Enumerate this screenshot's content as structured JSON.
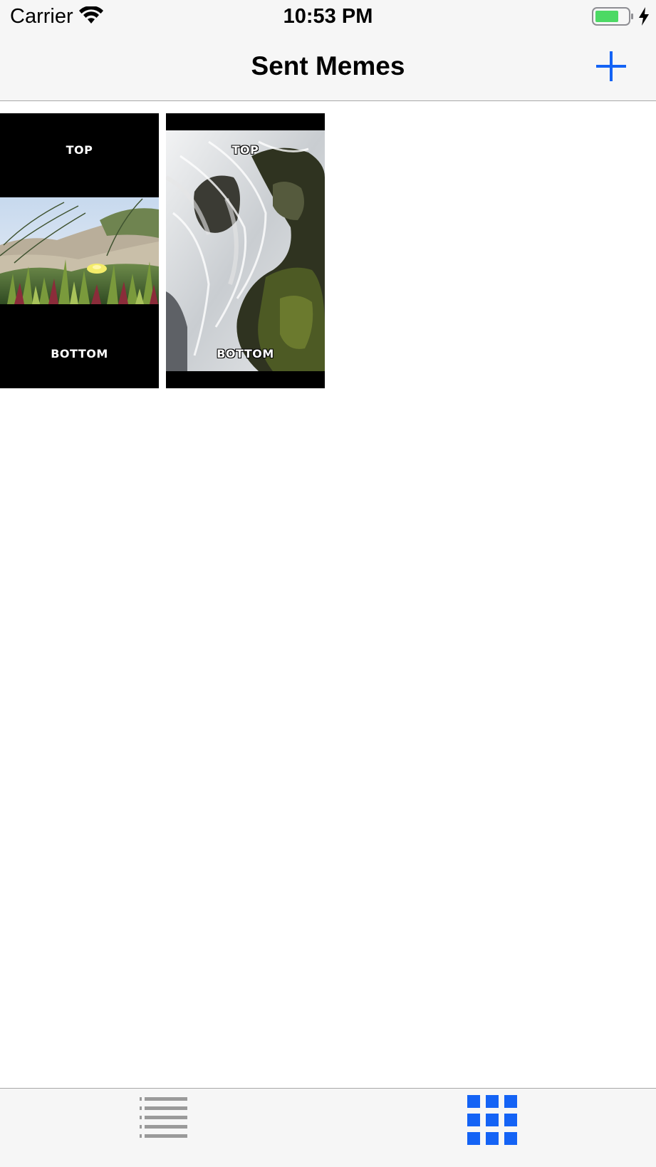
{
  "status_bar": {
    "carrier": "Carrier",
    "time": "10:53 PM",
    "battery_color": "#4cd964"
  },
  "nav_bar": {
    "title": "Sent Memes",
    "add_icon": "plus-icon",
    "accent_color": "#1463f5"
  },
  "memes": [
    {
      "top_text": "TOP",
      "bottom_text": "BOTTOM",
      "image": "beach grass with yellow flower"
    },
    {
      "top_text": "TOP",
      "bottom_text": "BOTTOM",
      "image": "waterfall over mossy rocks"
    }
  ],
  "tab_bar": {
    "tabs": [
      {
        "icon": "list-icon",
        "selected": false
      },
      {
        "icon": "grid-icon",
        "selected": true
      }
    ],
    "inactive_color": "#999999",
    "active_color": "#1463f5"
  }
}
